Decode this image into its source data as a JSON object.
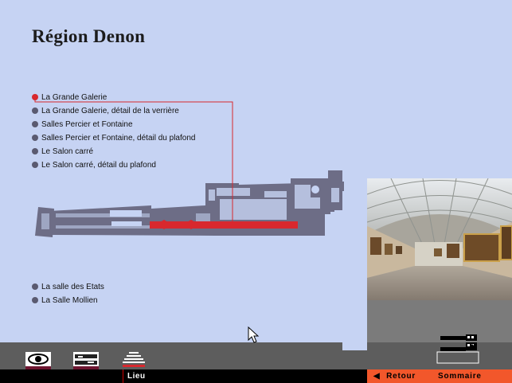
{
  "page": {
    "title": "Région Denon"
  },
  "rooms_upper": [
    {
      "label": "La Grande Galerie",
      "active": true
    },
    {
      "label": "La Grande Galerie, détail de la verrière",
      "active": false
    },
    {
      "label": "Salles Percier et Fontaine",
      "active": false
    },
    {
      "label": "Salles Percier et Fontaine, détail du plafond",
      "active": false
    },
    {
      "label": "Le Salon carré",
      "active": false
    },
    {
      "label": "Le Salon carré, détail du plafond",
      "active": false
    }
  ],
  "rooms_lower": [
    {
      "label": "La salle des Etats",
      "active": false
    },
    {
      "label": "La Salle Mollien",
      "active": false
    }
  ],
  "toolbar": {
    "view_icon": "eye-icon",
    "plan_icon": "floor-plan-icon",
    "lieu_icon": "museum-icon",
    "lieu_label": "Lieu"
  },
  "nav": {
    "back_label": "Retour",
    "back_icon": "left-arrow-icon",
    "summary_label": "Sommaire"
  },
  "colors": {
    "background": "#c6d3f3",
    "highlight": "#d8282e",
    "plan": "#6d6d86",
    "nav": "#f2572b"
  }
}
